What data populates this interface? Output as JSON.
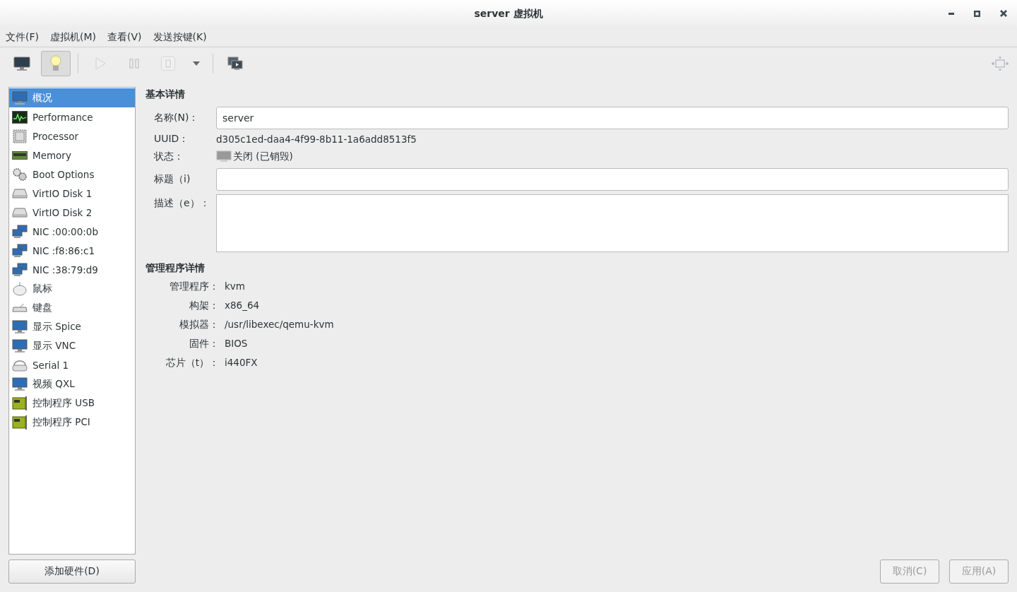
{
  "window": {
    "title": "server 虚拟机"
  },
  "menu": [
    "文件(F)",
    "虚拟机(M)",
    "查看(V)",
    "发送按键(K)"
  ],
  "toolbar": [
    {
      "kind": "console",
      "selected": false,
      "disabled": false
    },
    {
      "kind": "details",
      "selected": true,
      "disabled": false
    },
    {
      "kind": "run",
      "selected": false,
      "disabled": true
    },
    {
      "kind": "pause",
      "selected": false,
      "disabled": true
    },
    {
      "kind": "shutdown",
      "selected": false,
      "disabled": true
    },
    {
      "kind": "dropdown",
      "selected": false,
      "disabled": false
    },
    {
      "kind": "snapshots",
      "selected": false,
      "disabled": false
    }
  ],
  "sidebar": {
    "items": [
      {
        "label": "概况",
        "kind": "overview",
        "selected": true
      },
      {
        "label": "Performance",
        "kind": "performance",
        "selected": false
      },
      {
        "label": "Processor",
        "kind": "cpu",
        "selected": false
      },
      {
        "label": "Memory",
        "kind": "memory",
        "selected": false
      },
      {
        "label": "Boot Options",
        "kind": "gears",
        "selected": false
      },
      {
        "label": "VirtIO Disk 1",
        "kind": "disk",
        "selected": false
      },
      {
        "label": "VirtIO Disk 2",
        "kind": "disk",
        "selected": false
      },
      {
        "label": "NIC :00:00:0b",
        "kind": "nic",
        "selected": false
      },
      {
        "label": "NIC :f8:86:c1",
        "kind": "nic",
        "selected": false
      },
      {
        "label": "NIC :38:79:d9",
        "kind": "nic",
        "selected": false
      },
      {
        "label": "鼠标",
        "kind": "mouse",
        "selected": false
      },
      {
        "label": "键盘",
        "kind": "keyboard",
        "selected": false
      },
      {
        "label": "显示 Spice",
        "kind": "display",
        "selected": false
      },
      {
        "label": "显示 VNC",
        "kind": "display",
        "selected": false
      },
      {
        "label": "Serial 1",
        "kind": "serial",
        "selected": false
      },
      {
        "label": "视频 QXL",
        "kind": "display",
        "selected": false
      },
      {
        "label": "控制程序 USB",
        "kind": "controller",
        "selected": false
      },
      {
        "label": "控制程序 PCI",
        "kind": "controller",
        "selected": false
      }
    ],
    "add_button": "添加硬件(D)"
  },
  "basic": {
    "heading": "基本详情",
    "name_label": "名称(N)：",
    "name_value": "server",
    "uuid_label": "UUID：",
    "uuid_value": "d305c1ed-daa4-4f99-8b11-1a6add8513f5",
    "state_label": "状态：",
    "state_value": "关闭 (已销毁)",
    "title_label": "标题（i)",
    "description_label": "描述（e）："
  },
  "hypervisor": {
    "heading": "管理程序详情",
    "rows": [
      {
        "label": "管理程序：",
        "value": "kvm"
      },
      {
        "label": "构架：",
        "value": "x86_64"
      },
      {
        "label": "模拟器：",
        "value": "/usr/libexec/qemu-kvm"
      },
      {
        "label": "固件：",
        "value": "BIOS"
      },
      {
        "label": "芯片（t）：",
        "value": "i440FX"
      }
    ]
  },
  "footer": [
    {
      "label": "取消(C)",
      "disabled": true
    },
    {
      "label": "应用(A)",
      "disabled": true
    }
  ]
}
